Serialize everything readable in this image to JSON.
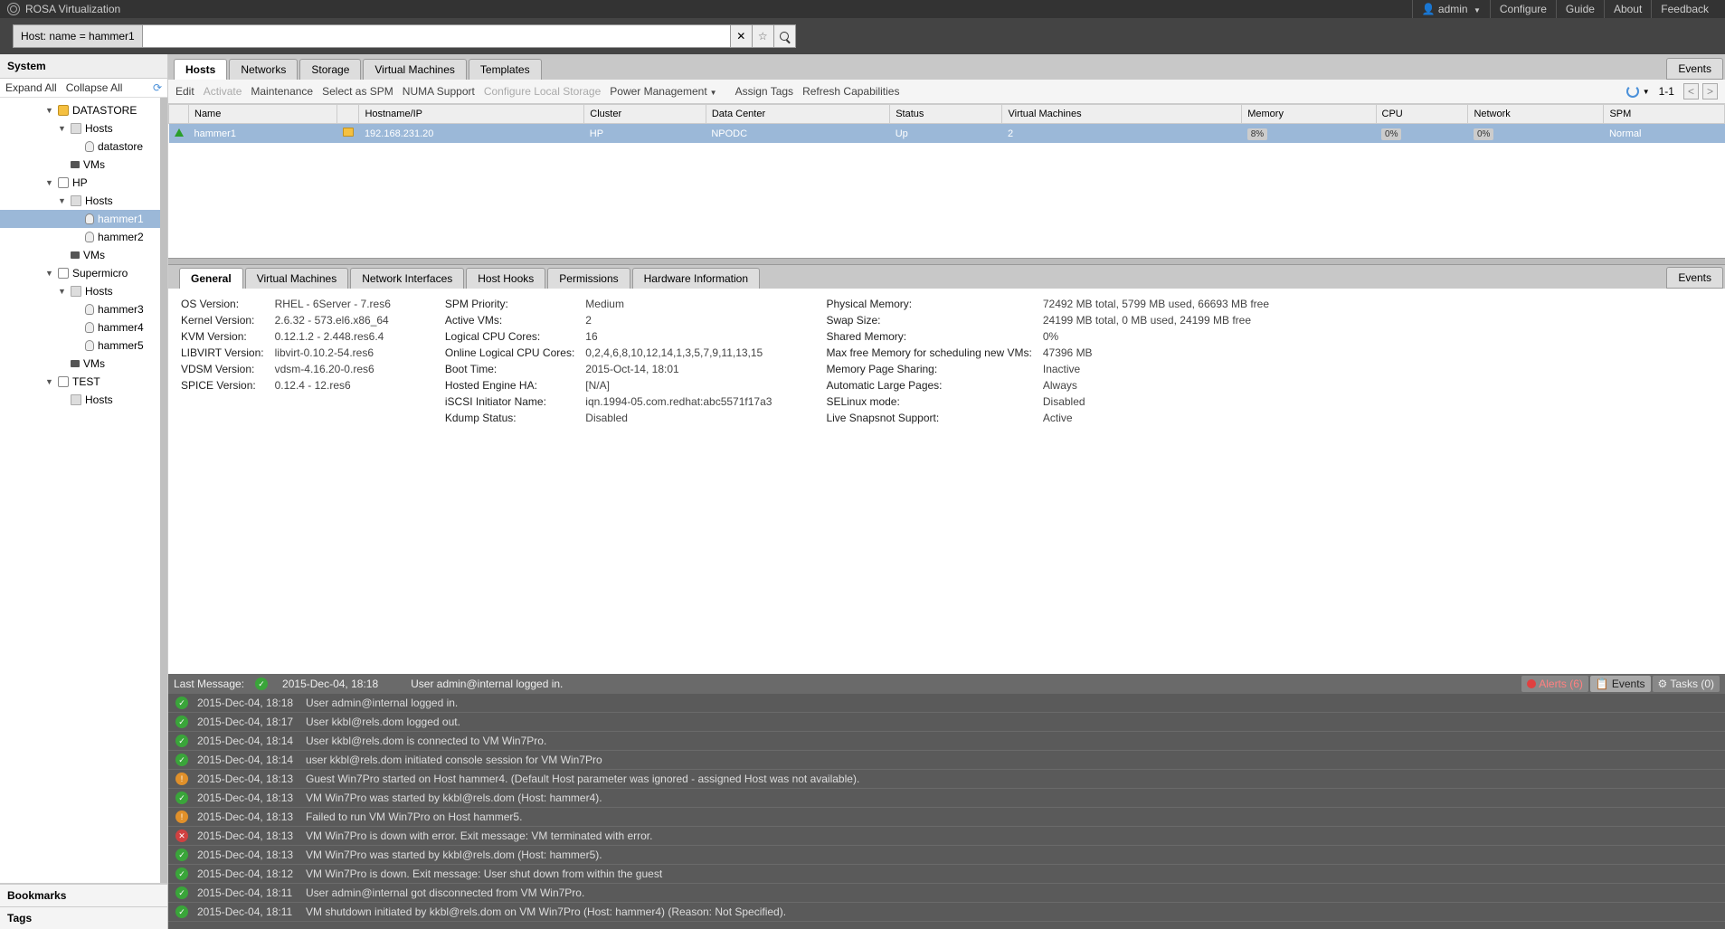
{
  "app_title": "ROSA Virtualization",
  "user_label": "admin",
  "top_links": [
    "Configure",
    "Guide",
    "About",
    "Feedback"
  ],
  "search_prefix": "Host: name = hammer1",
  "sidebar": {
    "header": "System",
    "expand": "Expand All",
    "collapse": "Collapse All",
    "bookmarks": "Bookmarks",
    "tags": "Tags",
    "tree": [
      {
        "indent": 1,
        "arrow": "▼",
        "icon": "dc",
        "label": "DATASTORE"
      },
      {
        "indent": 2,
        "arrow": "▼",
        "icon": "folder",
        "label": "Hosts"
      },
      {
        "indent": 3,
        "arrow": "",
        "icon": "host",
        "label": "datastore"
      },
      {
        "indent": 2,
        "arrow": "",
        "icon": "vm",
        "label": "VMs"
      },
      {
        "indent": 1,
        "arrow": "▼",
        "icon": "cluster",
        "label": "HP"
      },
      {
        "indent": 2,
        "arrow": "▼",
        "icon": "folder",
        "label": "Hosts"
      },
      {
        "indent": 3,
        "arrow": "",
        "icon": "host",
        "label": "hammer1",
        "selected": true
      },
      {
        "indent": 3,
        "arrow": "",
        "icon": "host",
        "label": "hammer2"
      },
      {
        "indent": 2,
        "arrow": "",
        "icon": "vm",
        "label": "VMs"
      },
      {
        "indent": 1,
        "arrow": "▼",
        "icon": "cluster",
        "label": "Supermicro"
      },
      {
        "indent": 2,
        "arrow": "▼",
        "icon": "folder",
        "label": "Hosts"
      },
      {
        "indent": 3,
        "arrow": "",
        "icon": "host",
        "label": "hammer3"
      },
      {
        "indent": 3,
        "arrow": "",
        "icon": "host",
        "label": "hammer4"
      },
      {
        "indent": 3,
        "arrow": "",
        "icon": "host",
        "label": "hammer5"
      },
      {
        "indent": 2,
        "arrow": "",
        "icon": "vm",
        "label": "VMs"
      },
      {
        "indent": 1,
        "arrow": "▼",
        "icon": "cluster",
        "label": "TEST"
      },
      {
        "indent": 2,
        "arrow": "",
        "icon": "folder",
        "label": "Hosts"
      }
    ]
  },
  "main_tabs": [
    "Hosts",
    "Networks",
    "Storage",
    "Virtual Machines",
    "Templates"
  ],
  "main_tabs_right": "Events",
  "toolbar": {
    "items": [
      {
        "label": "Edit"
      },
      {
        "label": "Activate",
        "disabled": true
      },
      {
        "label": "Maintenance"
      },
      {
        "label": "Select as SPM"
      },
      {
        "label": "NUMA Support"
      },
      {
        "label": "Configure Local Storage",
        "disabled": true
      },
      {
        "label": "Power Management",
        "caret": true
      },
      {
        "label": "Assign Tags"
      },
      {
        "label": "Refresh Capabilities"
      }
    ],
    "pager": "1-1"
  },
  "grid": {
    "cols": [
      "",
      "Name",
      "",
      "Hostname/IP",
      "Cluster",
      "Data Center",
      "Status",
      "Virtual Machines",
      "Memory",
      "CPU",
      "Network",
      "SPM"
    ],
    "row": {
      "name": "hammer1",
      "ip": "192.168.231.20",
      "cluster": "HP",
      "dc": "NPODC",
      "status": "Up",
      "vms": "2",
      "mem": "8%",
      "cpu": "0%",
      "net": "0%",
      "spm": "Normal"
    }
  },
  "sub_tabs": [
    "General",
    "Virtual Machines",
    "Network Interfaces",
    "Host Hooks",
    "Permissions",
    "Hardware Information"
  ],
  "sub_tabs_right": "Events",
  "details": {
    "col1": [
      [
        "OS Version:",
        "RHEL - 6Server - 7.res6"
      ],
      [
        "Kernel Version:",
        "2.6.32 - 573.el6.x86_64"
      ],
      [
        "KVM Version:",
        "0.12.1.2 - 2.448.res6.4"
      ],
      [
        "LIBVIRT Version:",
        "libvirt-0.10.2-54.res6"
      ],
      [
        "VDSM Version:",
        "vdsm-4.16.20-0.res6"
      ],
      [
        "SPICE Version:",
        "0.12.4 - 12.res6"
      ]
    ],
    "col2": [
      [
        "SPM Priority:",
        "Medium"
      ],
      [
        "Active VMs:",
        "2"
      ],
      [
        "Logical CPU Cores:",
        "16"
      ],
      [
        "Online Logical CPU Cores:",
        "0,2,4,6,8,10,12,14,1,3,5,7,9,11,13,15"
      ],
      [
        "Boot Time:",
        "2015-Oct-14, 18:01"
      ],
      [
        "Hosted Engine HA:",
        "[N/A]"
      ],
      [
        "iSCSI Initiator Name:",
        "iqn.1994-05.com.redhat:abc5571f17a3"
      ],
      [
        "Kdump Status:",
        "Disabled"
      ]
    ],
    "col3": [
      [
        "Physical Memory:",
        "72492 MB total, 5799 MB used, 66693 MB free"
      ],
      [
        "Swap Size:",
        "24199 MB total, 0 MB used, 24199 MB free"
      ],
      [
        "Shared Memory:",
        "0%"
      ],
      [
        "Max free Memory for scheduling new VMs:",
        "47396 MB"
      ],
      [
        "Memory Page Sharing:",
        "Inactive"
      ],
      [
        "Automatic Large Pages:",
        "Always"
      ],
      [
        "SELinux mode:",
        "Disabled"
      ],
      [
        "Live Snapsnot Support:",
        "Active"
      ]
    ]
  },
  "eventbar": {
    "last_label": "Last Message:",
    "last_time": "2015-Dec-04, 18:18",
    "last_msg": "User admin@internal logged in.",
    "alerts": "Alerts (6)",
    "events": "Events",
    "tasks": "Tasks (0)"
  },
  "events": [
    {
      "t": "ok",
      "time": "2015-Dec-04, 18:18",
      "msg": "User admin@internal logged in."
    },
    {
      "t": "ok",
      "time": "2015-Dec-04, 18:17",
      "msg": "User kkbl@rels.dom logged out."
    },
    {
      "t": "ok",
      "time": "2015-Dec-04, 18:14",
      "msg": "User kkbl@rels.dom is connected to VM Win7Pro."
    },
    {
      "t": "ok",
      "time": "2015-Dec-04, 18:14",
      "msg": "user kkbl@rels.dom initiated console session for VM Win7Pro"
    },
    {
      "t": "warn",
      "time": "2015-Dec-04, 18:13",
      "msg": "Guest Win7Pro started on Host hammer4. (Default Host parameter was ignored - assigned Host was not available)."
    },
    {
      "t": "ok",
      "time": "2015-Dec-04, 18:13",
      "msg": "VM Win7Pro was started by kkbl@rels.dom (Host: hammer4)."
    },
    {
      "t": "warn",
      "time": "2015-Dec-04, 18:13",
      "msg": "Failed to run VM Win7Pro on Host hammer5."
    },
    {
      "t": "err",
      "time": "2015-Dec-04, 18:13",
      "msg": "VM Win7Pro is down with error. Exit message: VM terminated with error."
    },
    {
      "t": "ok",
      "time": "2015-Dec-04, 18:13",
      "msg": "VM Win7Pro was started by kkbl@rels.dom (Host: hammer5)."
    },
    {
      "t": "ok",
      "time": "2015-Dec-04, 18:12",
      "msg": "VM Win7Pro is down. Exit message: User shut down from within the guest"
    },
    {
      "t": "ok",
      "time": "2015-Dec-04, 18:11",
      "msg": "User admin@internal got disconnected from VM Win7Pro."
    },
    {
      "t": "ok",
      "time": "2015-Dec-04, 18:11",
      "msg": "VM shutdown initiated by kkbl@rels.dom on VM Win7Pro (Host: hammer4) (Reason: Not Specified)."
    }
  ]
}
